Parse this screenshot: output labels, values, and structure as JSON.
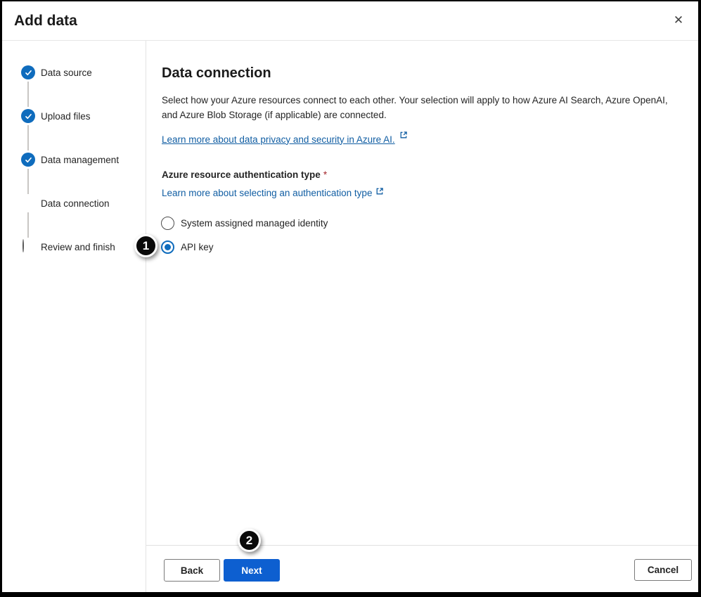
{
  "dialog": {
    "title": "Add data",
    "close_glyph": "✕"
  },
  "stepper": {
    "steps": [
      {
        "label": "Data source",
        "state": "complete"
      },
      {
        "label": "Upload files",
        "state": "complete"
      },
      {
        "label": "Data management",
        "state": "complete"
      },
      {
        "label": "Data connection",
        "state": "current"
      },
      {
        "label": "Review and finish",
        "state": "upcoming"
      }
    ]
  },
  "main": {
    "heading": "Data connection",
    "description_lines": [
      "Select how your Azure resources connect to each other. Your selection will apply to how Azure AI Search, Azure OpenAI,",
      "and Azure Blob Storage (if applicable) are connected."
    ],
    "privacy_link_label": "Learn more about data privacy and security in Azure AI.",
    "auth_type_label": "Azure resource authentication type",
    "required_marker": "*",
    "auth_learn_link_label": "Learn more about selecting an authentication type",
    "radio_options": [
      {
        "label": "System assigned managed identity",
        "selected": false
      },
      {
        "label": "API key",
        "selected": true
      }
    ]
  },
  "annotations": {
    "badge_1": "1",
    "badge_2": "2"
  },
  "footer": {
    "back_label": "Back",
    "next_label": "Next",
    "cancel_label": "Cancel"
  },
  "colors": {
    "brand_blue": "#0f6cbd",
    "link_blue": "#115ea3",
    "next_button_blue": "#0d5fd0",
    "required_red": "#a4262c",
    "annotation_black": "#0a0a0a",
    "frame_black": "#000000"
  }
}
